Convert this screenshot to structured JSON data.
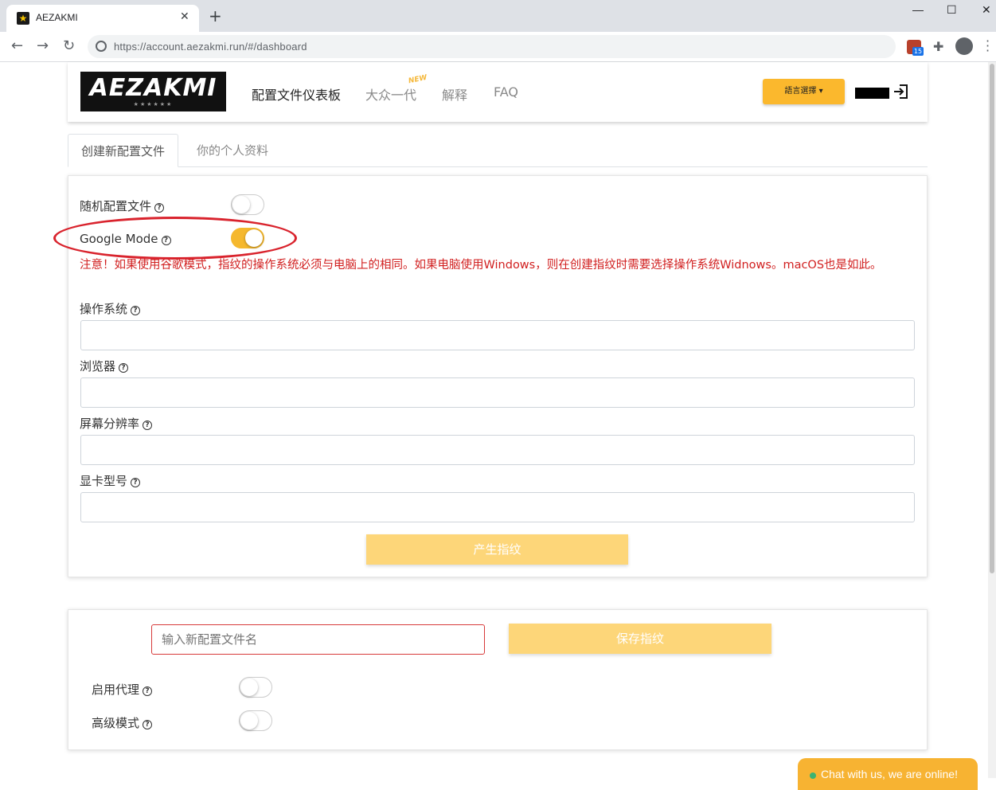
{
  "browser": {
    "tab_title": "AEZAKMI",
    "tab_close": "✕",
    "new_tab": "+",
    "url": "https://account.aezakmi.run/#/dashboard",
    "extension_badge": "15",
    "window_controls": {
      "minimize": "—",
      "maximize": "☐",
      "close": "✕"
    }
  },
  "header": {
    "logo_text": "AEZAKMI",
    "logo_stars": "★★★★★★",
    "nav": [
      {
        "label": "配置文件仪表板"
      },
      {
        "label": "大众一代"
      },
      {
        "label": "解释"
      },
      {
        "label": "FAQ"
      }
    ],
    "new_badge": "NEW",
    "language_button": "語言選擇 ▾"
  },
  "tabs": [
    {
      "label": "创建新配置文件"
    },
    {
      "label": "你的个人资料"
    }
  ],
  "form": {
    "random_profile_label": "随机配置文件",
    "random_profile_on": false,
    "google_mode_label": "Google Mode",
    "google_mode_on": true,
    "warning": "注意！如果使用谷歌模式，指纹的操作系统必须与电脑上的相同。如果电脑使用Windows，则在创建指纹时需要选择操作系统Widnows。macOS也是如此。",
    "os_label": "操作系统",
    "browser_label": "浏览器",
    "resolution_label": "屏幕分辨率",
    "gpu_label": "显卡型号",
    "generate_button": "产生指纹",
    "help_glyph": "?"
  },
  "save": {
    "name_placeholder": "输入新配置文件名",
    "save_button": "保存指纹",
    "proxy_label": "启用代理",
    "proxy_on": false,
    "advanced_label": "高级模式",
    "advanced_on": false
  },
  "chat": {
    "text": "Chat with us, we are online!"
  },
  "colors": {
    "accent": "#f5b82e",
    "warning": "#d11f1f",
    "highlight": "#d9232d"
  }
}
